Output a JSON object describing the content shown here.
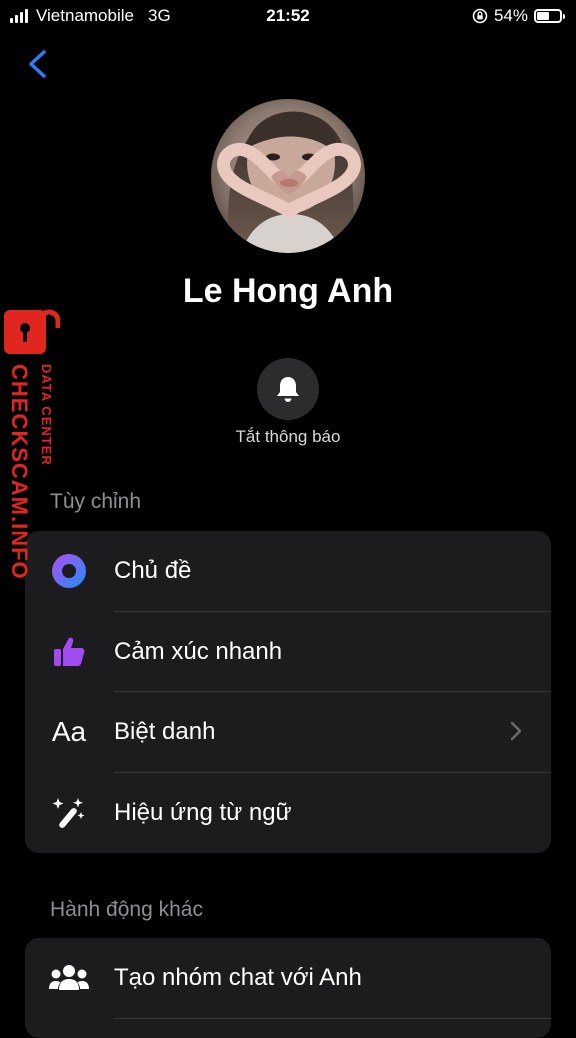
{
  "status_bar": {
    "carrier": "Vietnamobile",
    "network": "3G",
    "time": "21:52",
    "battery_percent": "54%",
    "battery_level": 0.54
  },
  "profile": {
    "name": "Le Hong Anh",
    "mute_label": "Tắt thông báo"
  },
  "customize": {
    "title": "Tùy chỉnh",
    "items": [
      {
        "label": "Chủ đề",
        "icon": "theme-icon"
      },
      {
        "label": "Cảm xúc nhanh",
        "icon": "thumbs-up-icon"
      },
      {
        "label": "Biệt danh",
        "icon": "text-aa-icon",
        "icon_text": "Aa"
      },
      {
        "label": "Hiệu ứng từ ngữ",
        "icon": "magic-wand-icon"
      }
    ]
  },
  "more_actions": {
    "title": "Hành động khác",
    "items": [
      {
        "label": "Tạo nhóm chat với Anh",
        "icon": "group-icon"
      }
    ]
  },
  "watermark": {
    "line1": "CHECKSCAM.INFO",
    "line2": "DATA CENTER"
  },
  "colors": {
    "accent_blue": "#2f7cf6",
    "theme_gradient_start": "#b14ff3",
    "theme_gradient_end": "#1f8ef5",
    "reaction_purple": "#a24cf0",
    "watermark_red": "#e0261f"
  }
}
